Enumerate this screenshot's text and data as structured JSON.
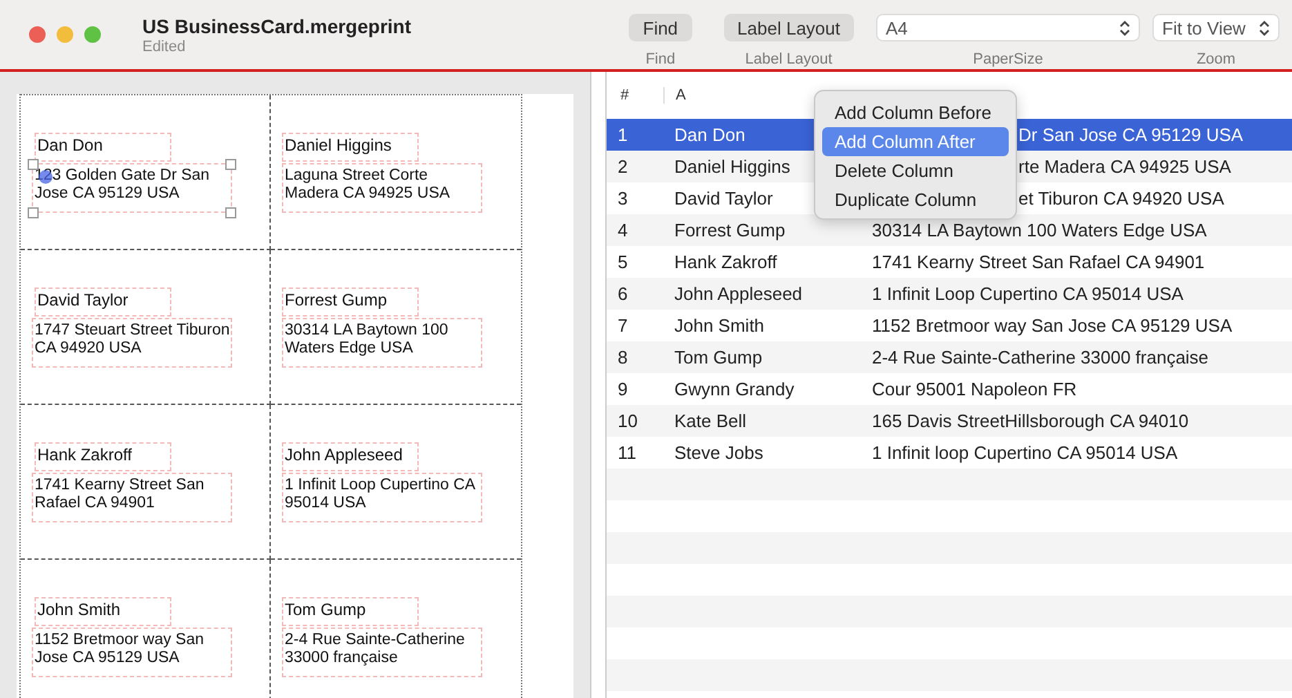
{
  "window": {
    "title": "US BusinessCard.mergeprint",
    "subtitle": "Edited"
  },
  "toolbar": [
    {
      "kind": "button",
      "text": "Find",
      "caption": "Find"
    },
    {
      "kind": "button",
      "text": "Label Layout",
      "caption": "Label Layout"
    },
    {
      "kind": "popup",
      "text": "A4",
      "caption": "PaperSize"
    },
    {
      "kind": "popup",
      "text": "Fit to View",
      "caption": "Zoom"
    }
  ],
  "labels": [
    {
      "name": "Dan Don",
      "address": "123 Golden Gate Dr San Jose CA 95129 USA",
      "selected": true
    },
    {
      "name": "Daniel Higgins",
      "address": "Laguna Street Corte Madera CA 94925 USA",
      "selected": false
    },
    {
      "name": "David Taylor",
      "address": "1747 Steuart Street Tiburon CA 94920 USA",
      "selected": false
    },
    {
      "name": "Forrest Gump",
      "address": "30314 LA Baytown 100 Waters Edge USA",
      "selected": false
    },
    {
      "name": "Hank Zakroff",
      "address": "1741 Kearny Street San Rafael CA 94901",
      "selected": false
    },
    {
      "name": "John Appleseed",
      "address": "1 Infinit Loop Cupertino CA 95014 USA",
      "selected": false
    },
    {
      "name": "John Smith",
      "address": "1152 Bretmoor way San Jose CA 95129 USA",
      "selected": false
    },
    {
      "name": "Tom Gump",
      "address": "2-4 Rue Sainte-Catherine 33000 française",
      "selected": false
    }
  ],
  "table": {
    "columns": [
      "#",
      "A"
    ],
    "rows": [
      {
        "index": "1",
        "a": "Dan Don",
        "b": "Dr San Jose CA 95129 USA",
        "covered": true,
        "selected": true
      },
      {
        "index": "2",
        "a": "Daniel Higgins",
        "b": "rte Madera CA 94925 USA",
        "covered": true,
        "selected": false
      },
      {
        "index": "3",
        "a": "David Taylor",
        "b": "et Tiburon CA 94920 USA",
        "covered": true,
        "selected": false
      },
      {
        "index": "4",
        "a": "Forrest Gump",
        "b": "30314 LA Baytown 100 Waters Edge USA",
        "selected": false
      },
      {
        "index": "5",
        "a": "Hank Zakroff",
        "b": "1741 Kearny Street San Rafael CA 94901",
        "selected": false
      },
      {
        "index": "6",
        "a": "John Appleseed",
        "b": "1 Infinit Loop Cupertino CA 95014 USA",
        "selected": false
      },
      {
        "index": "7",
        "a": "John Smith",
        "b": "1152 Bretmoor way San Jose CA 95129 USA",
        "selected": false
      },
      {
        "index": "8",
        "a": "Tom Gump",
        "b": "2-4 Rue Sainte-Catherine 33000 française",
        "selected": false
      },
      {
        "index": "9",
        "a": "Gwynn Grandy",
        "b": "Cour 95001 Napoleon FR",
        "selected": false
      },
      {
        "index": "10",
        "a": "Kate Bell",
        "b": "165 Davis StreetHillsborough CA 94010",
        "selected": false
      },
      {
        "index": "11",
        "a": "Steve Jobs",
        "b": "1 Infinit loop Cupertino CA 95014 USA",
        "selected": false
      }
    ]
  },
  "context_menu": [
    {
      "text": "Add Column Before",
      "selected": false
    },
    {
      "text": "Add Column After",
      "selected": true
    },
    {
      "text": "Delete Column",
      "selected": false
    },
    {
      "text": "Duplicate Column",
      "selected": false
    }
  ]
}
